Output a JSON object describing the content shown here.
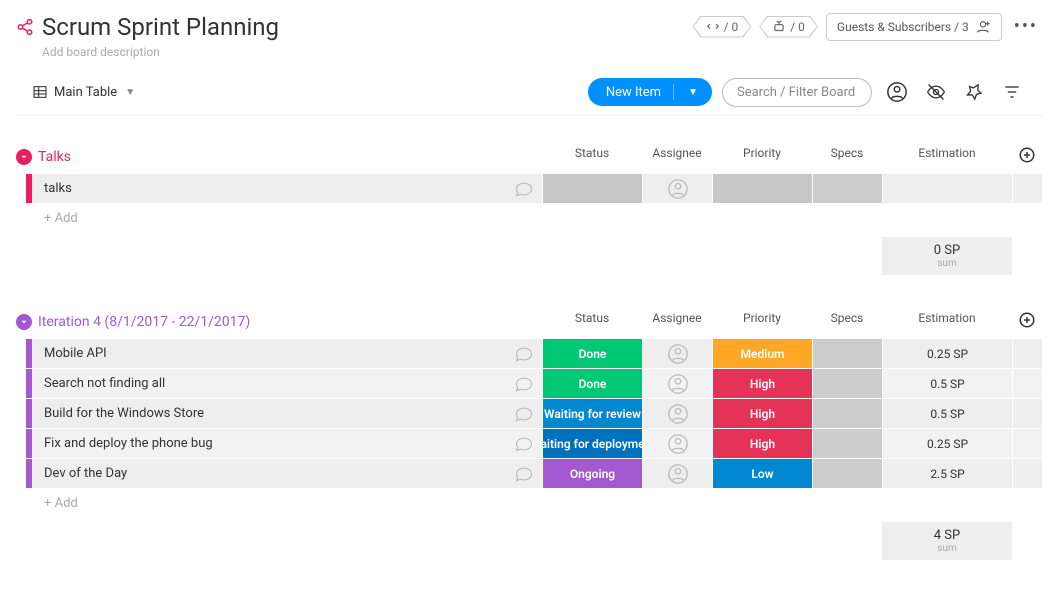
{
  "header": {
    "title": "Scrum Sprint Planning",
    "description_placeholder": "Add board description",
    "automation1": "/ 0",
    "automation2": "/ 0",
    "guests_label": "Guests & Subscribers / 3"
  },
  "toolbar": {
    "view_name": "Main Table",
    "new_item_label": "New Item",
    "search_placeholder": "Search / Filter Board"
  },
  "columns": {
    "status": "Status",
    "assignee": "Assignee",
    "priority": "Priority",
    "specs": "Specs",
    "estimation": "Estimation"
  },
  "add_label": "+ Add",
  "summary_label": "sum",
  "groups": [
    {
      "id": "talks",
      "title": "Talks",
      "color_class": "g-talks",
      "rows": [
        {
          "name": "talks",
          "status": "",
          "status_class": "",
          "priority": "",
          "priority_class": "",
          "estimation": ""
        }
      ],
      "summary": "0 SP"
    },
    {
      "id": "iter4",
      "title": "Iteration 4 (8/1/2017 - 22/1/2017)",
      "color_class": "g-iter",
      "rows": [
        {
          "name": "Mobile API",
          "status": "Done",
          "status_class": "c-done",
          "priority": "Medium",
          "priority_class": "p-medium",
          "estimation": "0.25 SP"
        },
        {
          "name": "Search not finding all",
          "status": "Done",
          "status_class": "c-done",
          "priority": "High",
          "priority_class": "p-high",
          "estimation": "0.5 SP"
        },
        {
          "name": "Build for the Windows Store",
          "status": "Waiting for review",
          "status_class": "c-waitrev",
          "priority": "High",
          "priority_class": "p-high",
          "estimation": "0.5 SP"
        },
        {
          "name": "Fix and deploy the phone bug",
          "status": "Waiting for deployme...",
          "status_class": "c-waitdep",
          "priority": "High",
          "priority_class": "p-high",
          "estimation": "0.25 SP"
        },
        {
          "name": "Dev of the Day",
          "status": "Ongoing",
          "status_class": "c-ongoing",
          "priority": "Low",
          "priority_class": "p-low",
          "estimation": "2.5 SP"
        }
      ],
      "summary": "4 SP"
    }
  ]
}
